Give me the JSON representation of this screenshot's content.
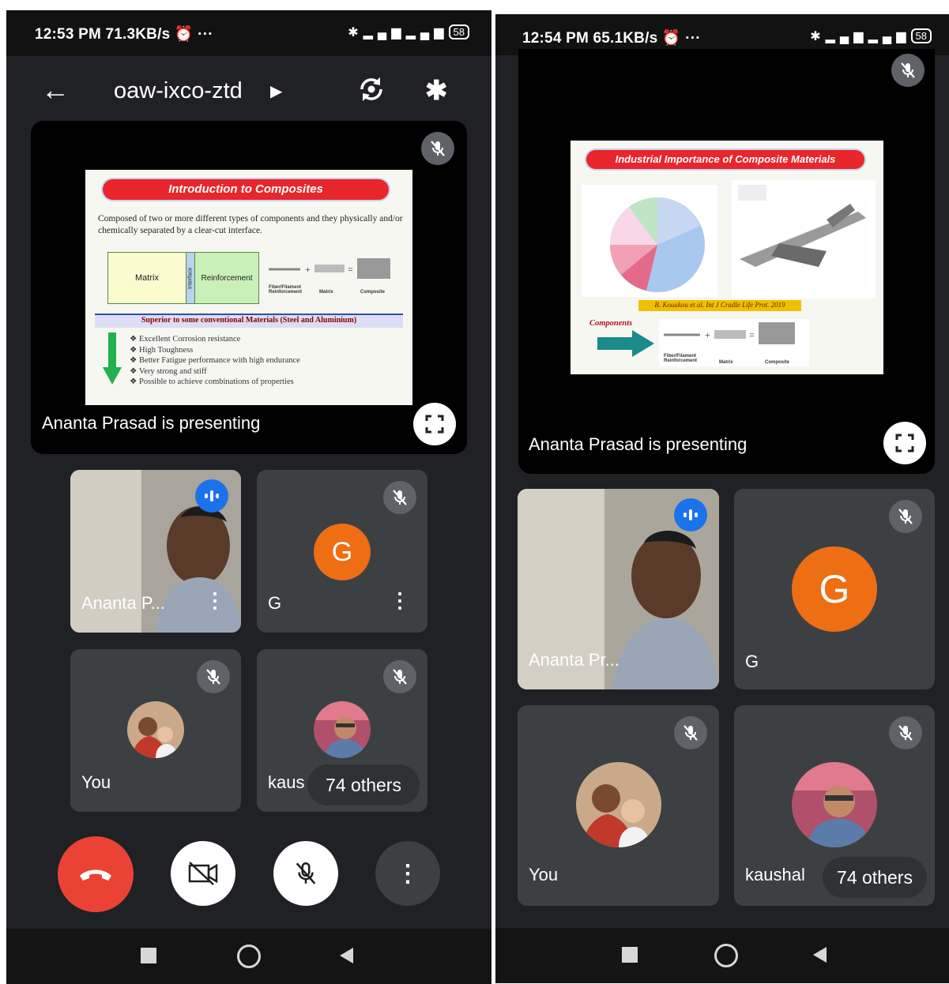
{
  "left": {
    "status": {
      "time": "12:53 PM",
      "speed": "71.3KB/s",
      "battery": "58"
    },
    "meeting_title": "oaw-ixco-ztd",
    "presenting_text": "Ananta Prasad is presenting",
    "slide": {
      "title": "Introduction to Composites",
      "body": "Composed of two or more different types of components and they physically and/or chemically separated by a clear-cut interface.",
      "matrix_label": "Matrix",
      "interface_label": "Interface",
      "reinforcement_label": "Reinforcement",
      "fig_labels": [
        "Fiber/Filament Reinforcement",
        "Matrix",
        "Composite"
      ],
      "subtitle": "Superior to some conventional Materials (Steel and Aluminium)",
      "bullets": [
        "Excellent Corrosion resistance",
        "High Toughness",
        "Better Fatigue performance with high endurance",
        "Very strong and stiff",
        "Possible to achieve combinations of properties"
      ]
    },
    "tiles": [
      {
        "name": "Ananta P...",
        "state": "speaking"
      },
      {
        "name": "G",
        "avatar_letter": "G",
        "state": "muted"
      },
      {
        "name": "You",
        "state": "muted"
      },
      {
        "name": "kaus",
        "state": "muted"
      }
    ],
    "others_label": "74 others"
  },
  "right": {
    "status": {
      "time": "12:54 PM",
      "speed": "65.1KB/s",
      "battery": "58"
    },
    "presenting_text": "Ananta Prasad is presenting",
    "slide": {
      "title": "Industrial Importance of Composite Materials",
      "citation": "B. Kouakou et al. Int J Cradle Life Prot. 2019",
      "components_label": "Components",
      "fig_labels": [
        "Fiber/Filament Reinforcement",
        "Matrix",
        "Composite"
      ]
    },
    "tiles": [
      {
        "name": "Ananta Pr...",
        "state": "speaking"
      },
      {
        "name": "G",
        "avatar_letter": "G",
        "state": "muted"
      },
      {
        "name": "You",
        "state": "muted"
      },
      {
        "name": "kaushal",
        "state": "muted"
      }
    ],
    "others_label": "74 others"
  },
  "colors": {
    "app_bg": "#202124",
    "tile_bg": "#3c4043",
    "end_call": "#ea4335",
    "avatar_orange": "#ee6e14",
    "speaking_blue": "#1a73e8"
  }
}
